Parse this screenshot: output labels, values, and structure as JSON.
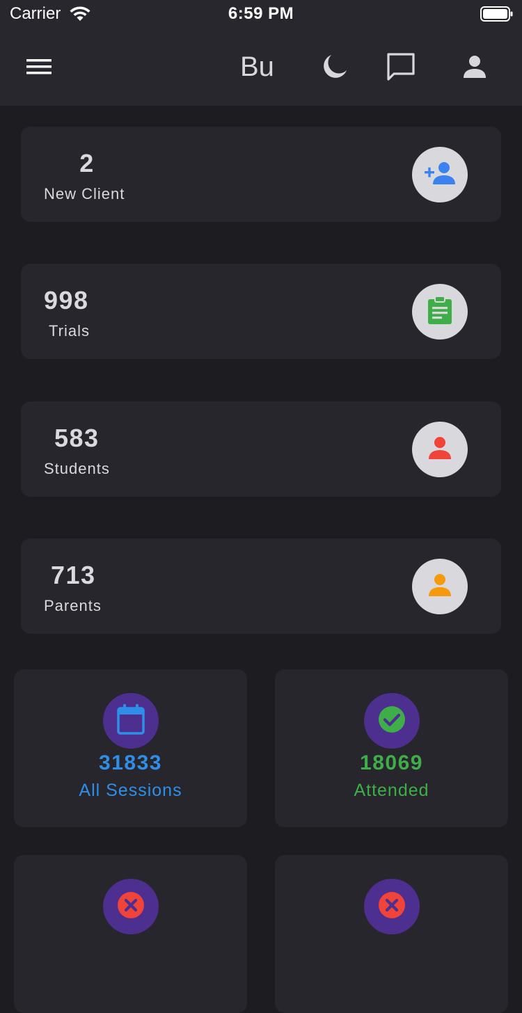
{
  "status_bar": {
    "carrier": "Carrier",
    "time": "6:59 PM"
  },
  "app_bar": {
    "title": "Bu",
    "icons": [
      "menu-icon",
      "moon-icon",
      "chat-icon",
      "person-icon"
    ]
  },
  "stats": [
    {
      "value": "2",
      "label": "New Client",
      "icon": "person-add-icon",
      "icon_color": "#3b82f0"
    },
    {
      "value": "998",
      "label": "Trials",
      "icon": "clipboard-icon",
      "icon_color": "#3fae49"
    },
    {
      "value": "583",
      "label": "Students",
      "icon": "person-icon",
      "icon_color": "#f0433a"
    },
    {
      "value": "713",
      "label": "Parents",
      "icon": "person-icon",
      "icon_color": "#f59a0c"
    }
  ],
  "sessions": [
    {
      "value": "31833",
      "label": "All Sessions",
      "icon": "calendar-icon",
      "color": "#2f8fe8"
    },
    {
      "value": "18069",
      "label": "Attended",
      "icon": "check-circle-icon",
      "color": "#3fae49"
    },
    {
      "icon": "cancel-icon",
      "color": "#f0433a"
    },
    {
      "icon": "cancel-icon",
      "color": "#f0433a"
    }
  ],
  "colors": {
    "background": "#1c1c21",
    "card": "#26262c",
    "bar": "#27272d",
    "badge_light": "#d8d8dd",
    "badge_purple": "#4c2f8f"
  }
}
